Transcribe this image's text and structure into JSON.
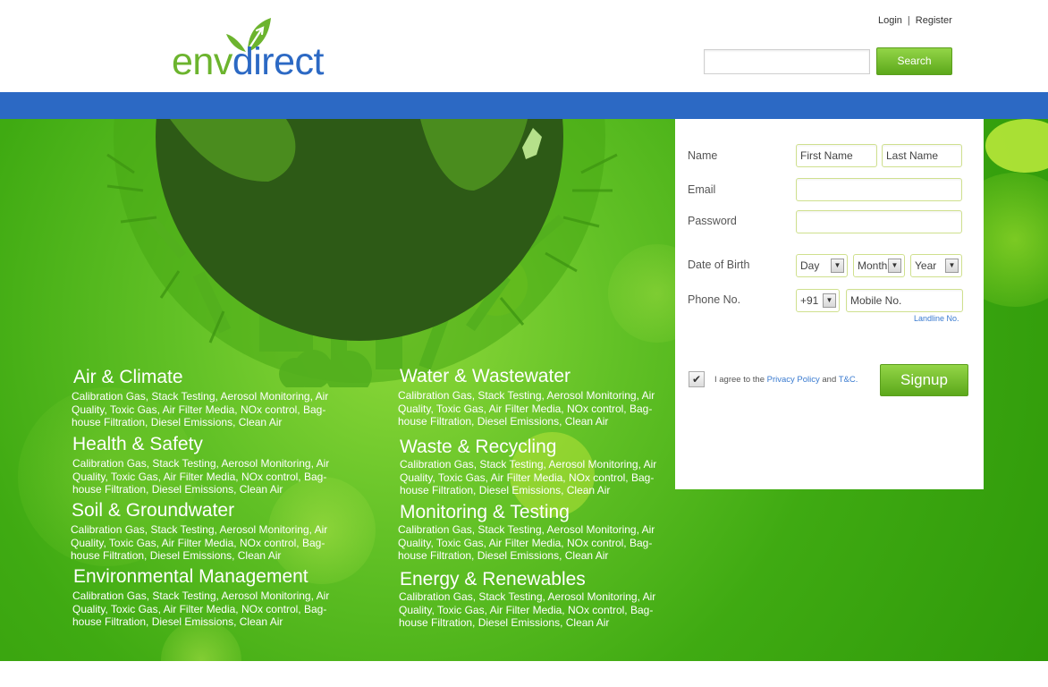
{
  "brand": {
    "logo_part1": "env",
    "logo_part2": "direct"
  },
  "header": {
    "login_label": "Login",
    "separator": "|",
    "register_label": "Register",
    "search_placeholder": "",
    "search_button_label": "Search"
  },
  "categories": [
    {
      "title": "Air & Climate",
      "desc": "Calibration Gas, Stack Testing, Aerosol Monitoring, Air Quality, Toxic Gas, Air Filter Media, NOx control, Bag-house Filtration, Diesel Emissions, Clean Air"
    },
    {
      "title": "Health & Safety",
      "desc": "Calibration Gas, Stack Testing, Aerosol Monitoring, Air Quality, Toxic Gas, Air Filter Media, NOx control, Bag-house Filtration, Diesel Emissions, Clean Air"
    },
    {
      "title": "Soil & Groundwater",
      "desc": "Calibration Gas, Stack Testing, Aerosol Monitoring, Air Quality, Toxic Gas, Air Filter Media, NOx control, Bag-house Filtration, Diesel Emissions, Clean Air"
    },
    {
      "title": "Environmental Management",
      "desc": "Calibration Gas, Stack Testing, Aerosol Monitoring, Air Quality, Toxic Gas, Air Filter Media, NOx control, Bag-house Filtration, Diesel Emissions, Clean Air"
    },
    {
      "title": "Water & Wastewater",
      "desc": "Calibration Gas, Stack Testing, Aerosol Monitoring, Air Quality, Toxic Gas, Air Filter Media, NOx control, Bag-house Filtration, Diesel Emissions, Clean Air"
    },
    {
      "title": "Waste & Recycling",
      "desc": "Calibration Gas, Stack Testing, Aerosol Monitoring, Air Quality, Toxic Gas, Air Filter Media, NOx control, Bag-house Filtration, Diesel Emissions, Clean Air"
    },
    {
      "title": "Monitoring & Testing",
      "desc": "Calibration Gas, Stack Testing, Aerosol Monitoring, Air Quality, Toxic Gas, Air Filter Media, NOx control, Bag-house Filtration, Diesel Emissions, Clean Air"
    },
    {
      "title": "Energy & Renewables",
      "desc": "Calibration Gas, Stack Testing, Aerosol Monitoring, Air Quality, Toxic Gas, Air Filter Media, NOx control, Bag-house Filtration, Diesel Emissions, Clean Air"
    }
  ],
  "signup": {
    "name_label": "Name",
    "first_name_placeholder": "First Name",
    "last_name_placeholder": "Last Name",
    "email_label": "Email",
    "password_label": "Password",
    "dob_label": "Date of Birth",
    "day_value": "Day",
    "month_value": "Month",
    "year_value": "Year",
    "phone_label": "Phone No.",
    "country_code_value": "+91",
    "mobile_placeholder": "Mobile No.",
    "landline_link": "Landline No.",
    "agree_prefix": "I agree to the",
    "privacy_link": "Privacy Policy",
    "and_text": "and",
    "tnc_link": "T&C.",
    "signup_button_label": "Signup",
    "checkbox_mark": "✔"
  },
  "colors": {
    "brand_green": "#6cb42e",
    "brand_blue": "#2c69c4",
    "button_green": "#6cb42e"
  }
}
